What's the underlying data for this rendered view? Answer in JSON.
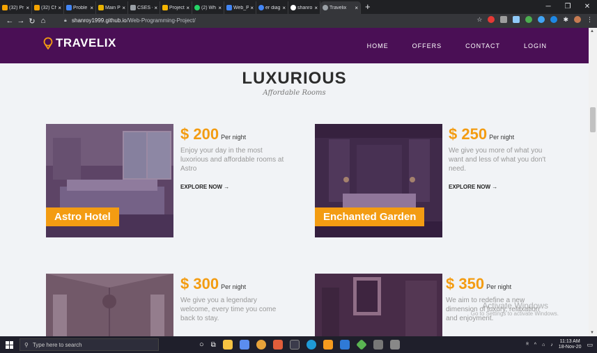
{
  "browser": {
    "tabs": [
      {
        "title": "(32) Pr",
        "color": "#f4a300"
      },
      {
        "title": "(32) Ch",
        "color": "#f4a300"
      },
      {
        "title": "Proble",
        "color": "#4285f4"
      },
      {
        "title": "Main P",
        "color": "#e8b200"
      },
      {
        "title": "CSES -",
        "color": "#9aa0a6"
      },
      {
        "title": "Project",
        "color": "#f4b400"
      },
      {
        "title": "(2) Wh",
        "color": "#25d366"
      },
      {
        "title": "Web_P",
        "color": "#4285f4"
      },
      {
        "title": "er diag",
        "color": "#4285f4"
      },
      {
        "title": "shanro",
        "color": "#ffffff"
      },
      {
        "title": "Travelix",
        "color": "#9aa0a6"
      }
    ],
    "active_tab_index": 10,
    "url_host": "shanroy1999.github.io",
    "url_path": "/Web-Programming-Project/"
  },
  "site": {
    "brand": "TRAVELIX",
    "menu": [
      "HOME",
      "OFFERS",
      "CONTACT",
      "LOGIN"
    ],
    "headline": "LUXURIOUS",
    "subhead": "Affordable Rooms",
    "accent_color": "#f39c12",
    "nav_color": "#4a0f55",
    "offers": [
      {
        "price": "$ 200",
        "per": "Per night",
        "desc": "Enjoy your day in the most luxorious and affordable rooms at Astro",
        "cta": "EXPLORE NOW →",
        "name": "Astro Hotel"
      },
      {
        "price": "$ 250",
        "per": "Per night",
        "desc": "We give you more of what you want and less of what you don't need.",
        "cta": "EXPLORE NOW →",
        "name": "Enchanted Garden"
      },
      {
        "price": "$ 300",
        "per": "Per night",
        "desc": "We give you a legendary welcome, every time you come back to stay.",
        "cta": "",
        "name": ""
      },
      {
        "price": "$ 350",
        "per": "Per night",
        "desc": "We aim to redefine a new dimension of luxury, relaxation and enjoyment.",
        "cta": "",
        "name": ""
      }
    ]
  },
  "os": {
    "watermark_title": "Activate Windows",
    "watermark_sub": "Go to Settings to activate Windows.",
    "search_placeholder": "Type here to search",
    "time": "11:13 AM",
    "date": "18-Nov-20"
  }
}
